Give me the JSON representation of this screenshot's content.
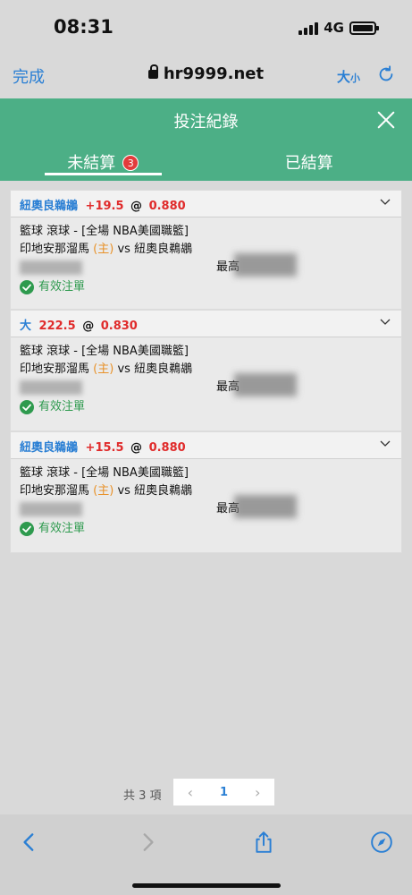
{
  "status": {
    "time": "08:31",
    "network": "4G"
  },
  "browser": {
    "done": "完成",
    "url": "hr9999.net",
    "text_size": "大",
    "text_size_small": "小"
  },
  "modal": {
    "title": "投注紀錄"
  },
  "tabs": [
    {
      "label": "未結算",
      "badge": "3"
    },
    {
      "label": "已結算"
    }
  ],
  "bets": [
    {
      "team": "紐奧良鵜鶘",
      "line": "+19.5",
      "at": "@",
      "odds": "0.880",
      "league": "籃球 滾球 - [全場 NBA美國職籃]",
      "home": "印地安那溜馬",
      "home_tag": "(主)",
      "vs": "vs",
      "away": "紐奧良鵜鶘",
      "hidden_label": "最高",
      "status": "有效注單"
    },
    {
      "team": "大",
      "line": "222.5",
      "at": "@",
      "odds": "0.830",
      "league": "籃球 滾球 - [全場 NBA美國職籃]",
      "home": "印地安那溜馬",
      "home_tag": "(主)",
      "vs": "vs",
      "away": "紐奧良鵜鶘",
      "hidden_label": "最高",
      "status": "有效注單"
    },
    {
      "team": "紐奧良鵜鶘",
      "line": "+15.5",
      "at": "@",
      "odds": "0.880",
      "league": "籃球 滾球 - [全場 NBA美國職籃]",
      "home": "印地安那溜馬",
      "home_tag": "(主)",
      "vs": "vs",
      "away": "紐奧良鵜鶘",
      "hidden_label": "最高",
      "status": "有效注單"
    }
  ],
  "pager": {
    "total": "共 3 項",
    "prev": "‹",
    "current": "1",
    "next": "›"
  },
  "colors": {
    "header": "#4caf86",
    "link": "#2a7fd4",
    "odds": "#e02b2b",
    "home_tag": "#e8922a",
    "valid": "#2e9a4e",
    "badge": "#e23c3c"
  }
}
